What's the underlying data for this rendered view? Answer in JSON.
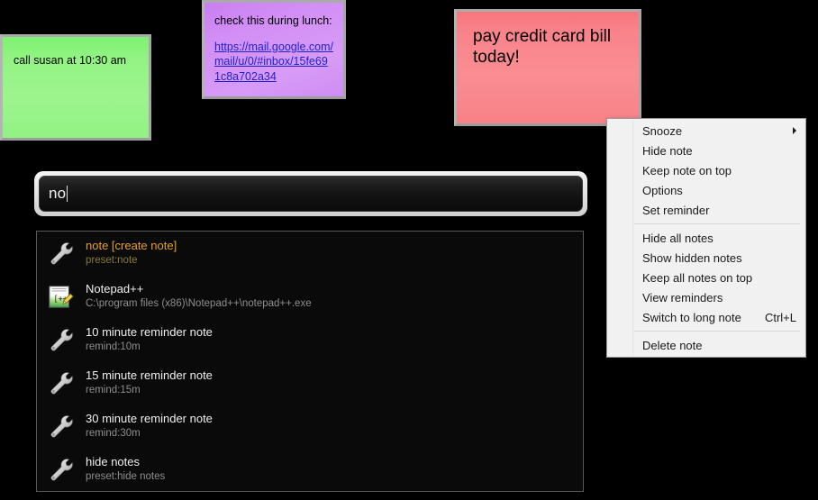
{
  "notes": [
    {
      "id": "note-green",
      "name": "sticky-note-green",
      "color": "#93f383",
      "text": "call susan at 10:30 am"
    },
    {
      "id": "note-purple",
      "name": "sticky-note-purple",
      "color": "#d28ef5",
      "line1": "check this during lunch:",
      "link": "https://mail.google.com/mail/u/0/#inbox/15fe691c8a702a34"
    },
    {
      "id": "note-pink",
      "name": "sticky-note-pink",
      "color": "#f9838a",
      "text": "pay credit card bill today!"
    }
  ],
  "search": {
    "value": "no",
    "placeholder": ""
  },
  "results": [
    {
      "icon": "wrench-icon",
      "title": "note [create note]",
      "subtitle": "preset:note",
      "selected": true
    },
    {
      "icon": "notepadpp-icon",
      "title": "Notepad++",
      "subtitle": "C:\\program files (x86)\\Notepad++\\notepad++.exe",
      "selected": false
    },
    {
      "icon": "wrench-icon",
      "title": "10 minute reminder note",
      "subtitle": "remind:10m",
      "selected": false
    },
    {
      "icon": "wrench-icon",
      "title": "15 minute reminder note",
      "subtitle": "remind:15m",
      "selected": false
    },
    {
      "icon": "wrench-icon",
      "title": "30 minute reminder note",
      "subtitle": "remind:30m",
      "selected": false
    },
    {
      "icon": "wrench-icon",
      "title": "hide notes",
      "subtitle": "preset:hide notes",
      "selected": false
    }
  ],
  "context_menu": {
    "group1": [
      {
        "label": "Snooze",
        "shortcut": "",
        "submenu": true
      },
      {
        "label": "Hide note",
        "shortcut": "",
        "submenu": false
      },
      {
        "label": "Keep note on top",
        "shortcut": "",
        "submenu": false
      },
      {
        "label": "Options",
        "shortcut": "",
        "submenu": false
      },
      {
        "label": "Set reminder",
        "shortcut": "",
        "submenu": false
      }
    ],
    "group2": [
      {
        "label": "Hide all notes",
        "shortcut": "",
        "submenu": false
      },
      {
        "label": "Show hidden notes",
        "shortcut": "",
        "submenu": false
      },
      {
        "label": "Keep all notes on top",
        "shortcut": "",
        "submenu": false
      },
      {
        "label": "View reminders",
        "shortcut": "",
        "submenu": false
      },
      {
        "label": "Switch to long note",
        "shortcut": "Ctrl+L",
        "submenu": false
      }
    ],
    "group3": [
      {
        "label": "Delete note",
        "shortcut": "",
        "submenu": false
      }
    ]
  },
  "colors": {
    "desktop_background": "#000000",
    "selected_result": "#e8a020",
    "result_text": "#f0f0f0",
    "result_subtext": "#8e8e8e",
    "menu_background": "#f1f1f1",
    "link": "#2222cc"
  }
}
